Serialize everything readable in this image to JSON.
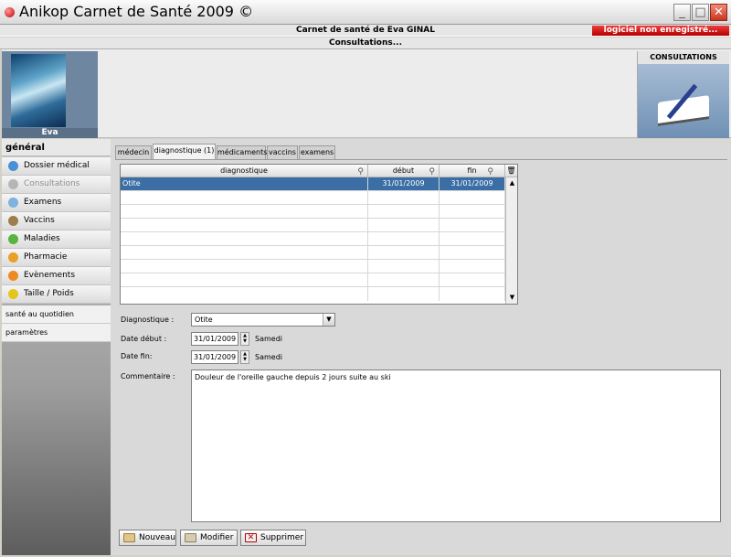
{
  "window": {
    "title": "Anikop Carnet de Santé 2009 ©"
  },
  "header": {
    "patient_line": "Carnet de santé de Eva GINAL",
    "section_line": "Consultations...",
    "unregistered": "logiciel non enregistré..."
  },
  "profile": {
    "name": "Eva"
  },
  "module": {
    "title": "CONSULTATIONS"
  },
  "sidebar": {
    "heading": "général",
    "items": [
      {
        "label": "Dossier médical",
        "icon": "medical-file-icon",
        "color": "#4a90d9"
      },
      {
        "label": "Consultations",
        "icon": "stethoscope-icon",
        "color": "#9a9a9a",
        "disabled": true
      },
      {
        "label": "Examens",
        "icon": "magnifier-icon",
        "color": "#7fb2df"
      },
      {
        "label": "Vaccins",
        "icon": "syringe-icon",
        "color": "#9f7e4d"
      },
      {
        "label": "Maladies",
        "icon": "virus-icon",
        "color": "#58b441"
      },
      {
        "label": "Pharmacie",
        "icon": "pill-icon",
        "color": "#e8a02a"
      },
      {
        "label": "Evènements",
        "icon": "lightning-icon",
        "color": "#ef8a22"
      },
      {
        "label": "Taille / Poids",
        "icon": "scale-icon",
        "color": "#e2c61b"
      }
    ],
    "sections": [
      "santé au quotidien",
      "paramètres"
    ]
  },
  "tabs": [
    "médecin",
    "diagnostique (1)",
    "médicaments",
    "vaccins",
    "examens"
  ],
  "grid": {
    "columns": [
      "diagnostique",
      "début",
      "fin"
    ],
    "rows": [
      {
        "diagnostique": "Otite",
        "debut": "31/01/2009",
        "fin": "31/01/2009"
      }
    ]
  },
  "form": {
    "diag_label": "Diagnostique :",
    "diag_value": "Otite",
    "start_label": "Date début :",
    "start_value": "31/01/2009",
    "start_day": "Samedi",
    "end_label": "Date fin:",
    "end_value": "31/01/2009",
    "end_day": "Samedi",
    "comment_label": "Commentaire :",
    "comment_value": "Douleur de l'oreille gauche depuis 2 jours suite au ski"
  },
  "buttons": {
    "new": "Nouveau",
    "edit": "Modifier",
    "delete": "Supprimer"
  },
  "colors": {
    "selection": "#3a6ea5",
    "unregistered": "#d40000",
    "close": "#d0452c"
  }
}
